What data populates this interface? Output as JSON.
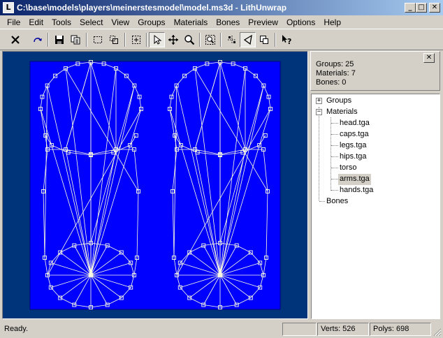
{
  "window": {
    "title": "C:\\base\\models\\players\\meinerstesmodel\\model.ms3d - LithUnwrap",
    "minimize_glyph": "_",
    "maximize_glyph": "□",
    "close_glyph": "✕"
  },
  "menu": [
    "File",
    "Edit",
    "Tools",
    "Select",
    "View",
    "Groups",
    "Materials",
    "Bones",
    "Preview",
    "Options",
    "Help"
  ],
  "toolbar": {
    "icons": [
      "close-x-icon",
      "redo-arrow-icon",
      "save-disk-icon",
      "copy-icon",
      "select-rect-icon",
      "select-lasso-icon",
      "select-center-icon",
      "pointer-icon",
      "move-icon",
      "zoom-icon",
      "zoom-fit-icon",
      "vertex-mode-icon",
      "triangle-mode-icon",
      "group-mode-icon",
      "context-help-icon"
    ],
    "pressed": [
      "pointer-icon",
      "triangle-mode-icon"
    ]
  },
  "info": {
    "groups_text": "Groups: 25",
    "materials_text": "Materials: 7",
    "bones_text": "Bones: 0",
    "close_glyph": "✕"
  },
  "tree": {
    "groups_label": "Groups",
    "materials_label": "Materials",
    "materials": [
      "head.tga",
      "caps.tga",
      "legs.tga",
      "hips.tga",
      "torso",
      "arms.tga",
      "hands.tga"
    ],
    "selected_material": "arms.tga",
    "bones_label": "Bones",
    "expand_glyph": "+",
    "collapse_glyph": "−"
  },
  "status": {
    "message": "Ready.",
    "verts": "Verts: 526",
    "polys": "Polys: 698"
  },
  "colors": {
    "viewport_bg": "#00347a",
    "uv_area": "#0000ff",
    "wire": "#ffffe0",
    "selection": "#d4d0c8"
  }
}
